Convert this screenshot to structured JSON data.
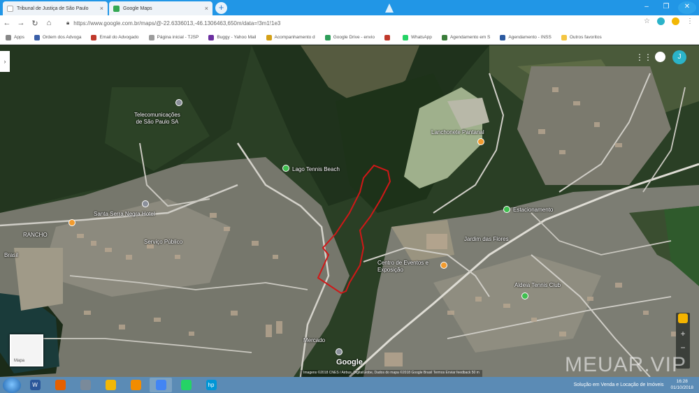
{
  "browser": {
    "tabs": [
      {
        "title": "Tribunal de Justiça de São Paulo",
        "favicon_color": "#ffffff"
      },
      {
        "title": "Google Maps",
        "favicon_color": "#34a853"
      }
    ],
    "new_tab_icon": "plus-icon",
    "address": "https://www.google.com.br/maps/@-22.6336013,-46.1306463,650m/data=!3m1!1e3",
    "bookmarks": [
      {
        "label": "Apps",
        "color": "#888888"
      },
      {
        "label": "Ordem dos Advoga",
        "color": "#3a5fa8"
      },
      {
        "label": "Email do Advogado",
        "color": "#c0392b"
      },
      {
        "label": "Página inicial - TJSP",
        "color": "#9c9c9c"
      },
      {
        "label": "Buggy - Yahoo Mail",
        "color": "#6b2fa0"
      },
      {
        "label": "Acompanhamento d",
        "color": "#d4a017"
      },
      {
        "label": "Google Drive - envio",
        "color": "#2e9e5a"
      },
      {
        "label": "",
        "color": "#c0392b"
      },
      {
        "label": "WhatsApp",
        "color": "#25d366"
      },
      {
        "label": "Agendamento em S",
        "color": "#3b7d3b"
      },
      {
        "label": "Agendamento - INSS",
        "color": "#2c5aa0"
      },
      {
        "label": "Outros favoritos",
        "color": "#f4c542"
      }
    ]
  },
  "map": {
    "labels": [
      {
        "text": "Telecomunicações\nde São Paulo SA",
        "name": "telecom-label"
      },
      {
        "text": "Lanchonete Pantanal",
        "name": "lanchonete-label"
      },
      {
        "text": "Lago Tennis Beach",
        "name": "tennis-beach-label"
      },
      {
        "text": "Santa Serra Negra Hotel",
        "name": "hotel-label"
      },
      {
        "text": "Estacionamento",
        "name": "estacionamento-label"
      },
      {
        "text": "Serviço Público",
        "name": "servico-publico-label"
      },
      {
        "text": "RANCHO",
        "name": "rancho-label"
      },
      {
        "text": "Brasil",
        "name": "brasil-label"
      },
      {
        "text": "Jardim das Flores",
        "name": "jardim-label"
      },
      {
        "text": "Centro de Eventos e Exposição",
        "name": "eventos-label"
      },
      {
        "text": "Aldeia Tennis Club",
        "name": "tennis-club-label"
      },
      {
        "text": "Mercado",
        "name": "mercado-label"
      }
    ],
    "google_logo": "Google",
    "attribution": "Imagens ©2018 CNES / Airbus, DigitalGlobe, Dados do mapa ©2018 Google  Brasil  Termos  Enviar feedback  50 m",
    "layer_label": "Mapa",
    "avatar_letter": "J",
    "watermark": "MEUAR.VIP",
    "colors": {
      "polygon": "#d01818",
      "vegetation": "#2d4a25",
      "urban": "#8a8a80"
    }
  },
  "taskbar": {
    "apps": [
      {
        "name": "word-app",
        "color": "#2b579a",
        "label": "W"
      },
      {
        "name": "firefox-app",
        "color": "#e66000",
        "label": ""
      },
      {
        "name": "tools-app",
        "color": "#7a8a9a",
        "label": ""
      },
      {
        "name": "yellow-app",
        "color": "#f2b705",
        "label": ""
      },
      {
        "name": "orange-app",
        "color": "#f28c00",
        "label": ""
      },
      {
        "name": "chrome-app",
        "color": "#4285f4",
        "label": ""
      },
      {
        "name": "whatsapp-app",
        "color": "#25d366",
        "label": ""
      },
      {
        "name": "hp-app",
        "color": "#0096d6",
        "label": "hp"
      }
    ],
    "tray_text": "Solução em Venda e Locação de Imóveis",
    "time": "16:28",
    "date": "01/10/2018"
  }
}
